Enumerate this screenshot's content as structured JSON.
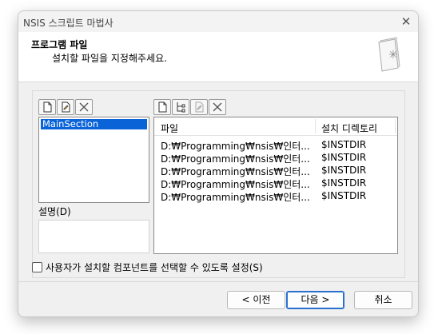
{
  "window": {
    "title": "NSIS 스크립트 마법사",
    "close_glyph": "✕"
  },
  "header": {
    "title": "프로그램 파일",
    "subtitle": "설치할 파일을 지정해주세요."
  },
  "sections": {
    "items": [
      "MainSection"
    ],
    "description_label": "설명(D)",
    "description_text": ""
  },
  "files": {
    "columns": [
      "파일",
      "설치 디렉토리"
    ],
    "rows": [
      {
        "file": "D:₩Programming₩nsis₩인터...",
        "dir": "$INSTDIR"
      },
      {
        "file": "D:₩Programming₩nsis₩인터...",
        "dir": "$INSTDIR"
      },
      {
        "file": "D:₩Programming₩nsis₩인터...",
        "dir": "$INSTDIR"
      },
      {
        "file": "D:₩Programming₩nsis₩인터...",
        "dir": "$INSTDIR"
      },
      {
        "file": "D:₩Programming₩nsis₩인터...",
        "dir": "$INSTDIR"
      }
    ]
  },
  "checkbox": {
    "label": "사용자가 설치할 컴포넌트를 선택할 수 있도록 설정(S)",
    "checked": false
  },
  "buttons": {
    "back": "< 이전",
    "next": "다음 >",
    "cancel": "취소"
  },
  "colors": {
    "selection": "#0a64d8",
    "default_button_border": "#2a71cf"
  }
}
